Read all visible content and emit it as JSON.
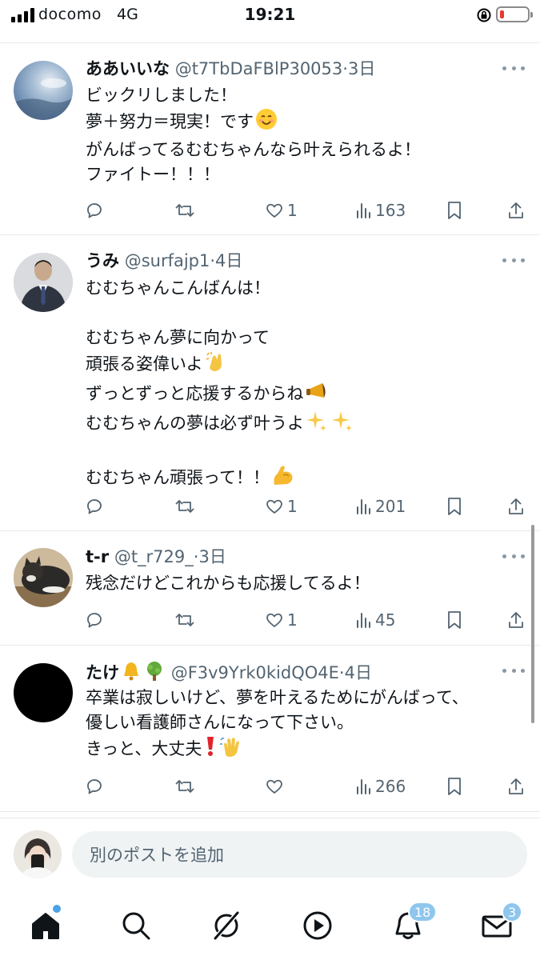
{
  "status_bar": {
    "carrier": "docomo",
    "network": "4G",
    "time": "19:21"
  },
  "tweets": [
    {
      "name": "ああいいな",
      "handle": "@t7TbDaFBlP30053",
      "separator": "·",
      "time": "3日",
      "lines": [
        "ビックリしました！",
        "夢＋努力＝現実！です",
        "がんばってるむむちゃんなら叶えられるよ！",
        "ファイトー！！！"
      ],
      "emoji": [
        "smiling-face"
      ],
      "likes": "1",
      "views": "163"
    },
    {
      "name": "うみ",
      "handle": "@surfajp1",
      "separator": "·",
      "time": "4日",
      "lines": [
        "むむちゃんこんばんは！",
        "",
        "むむちゃん夢に向かって",
        "頑張る姿偉いよ",
        "ずっとずっと応援するからね",
        "むむちゃんの夢は必ず叶うよ",
        "",
        "むむちゃん頑張って！！"
      ],
      "emoji": [
        "clapping-hands",
        "megaphone",
        "sparkles",
        "flexed-biceps"
      ],
      "likes": "1",
      "views": "201"
    },
    {
      "name": "t-r",
      "handle": "@t_r729_",
      "separator": "·",
      "time": "3日",
      "lines": [
        "残念だけどこれからも応援してるよ！"
      ],
      "emoji": [],
      "likes": "1",
      "views": "45"
    },
    {
      "name": "たけ",
      "handle": "@F3v9Yrk0kidQO4E",
      "separator": "·",
      "time": "4日",
      "lines": [
        "卒業は寂しいけど、夢を叶えるためにがんばって、",
        "優しい看護師さんになって下さい。",
        "きっと、大丈夫"
      ],
      "emoji": [
        "bell",
        "tree",
        "exclamation-mark",
        "waving-hand"
      ],
      "likes": "",
      "views": "266"
    }
  ],
  "reply": {
    "placeholder": "別のポストを追加"
  },
  "tabbar": {
    "notifications_badge": "18",
    "messages_badge": "3"
  },
  "colors": {
    "text": "#0f1419",
    "muted": "#536471",
    "badge": "#8ec6ee",
    "divider": "#e4e8eb"
  }
}
